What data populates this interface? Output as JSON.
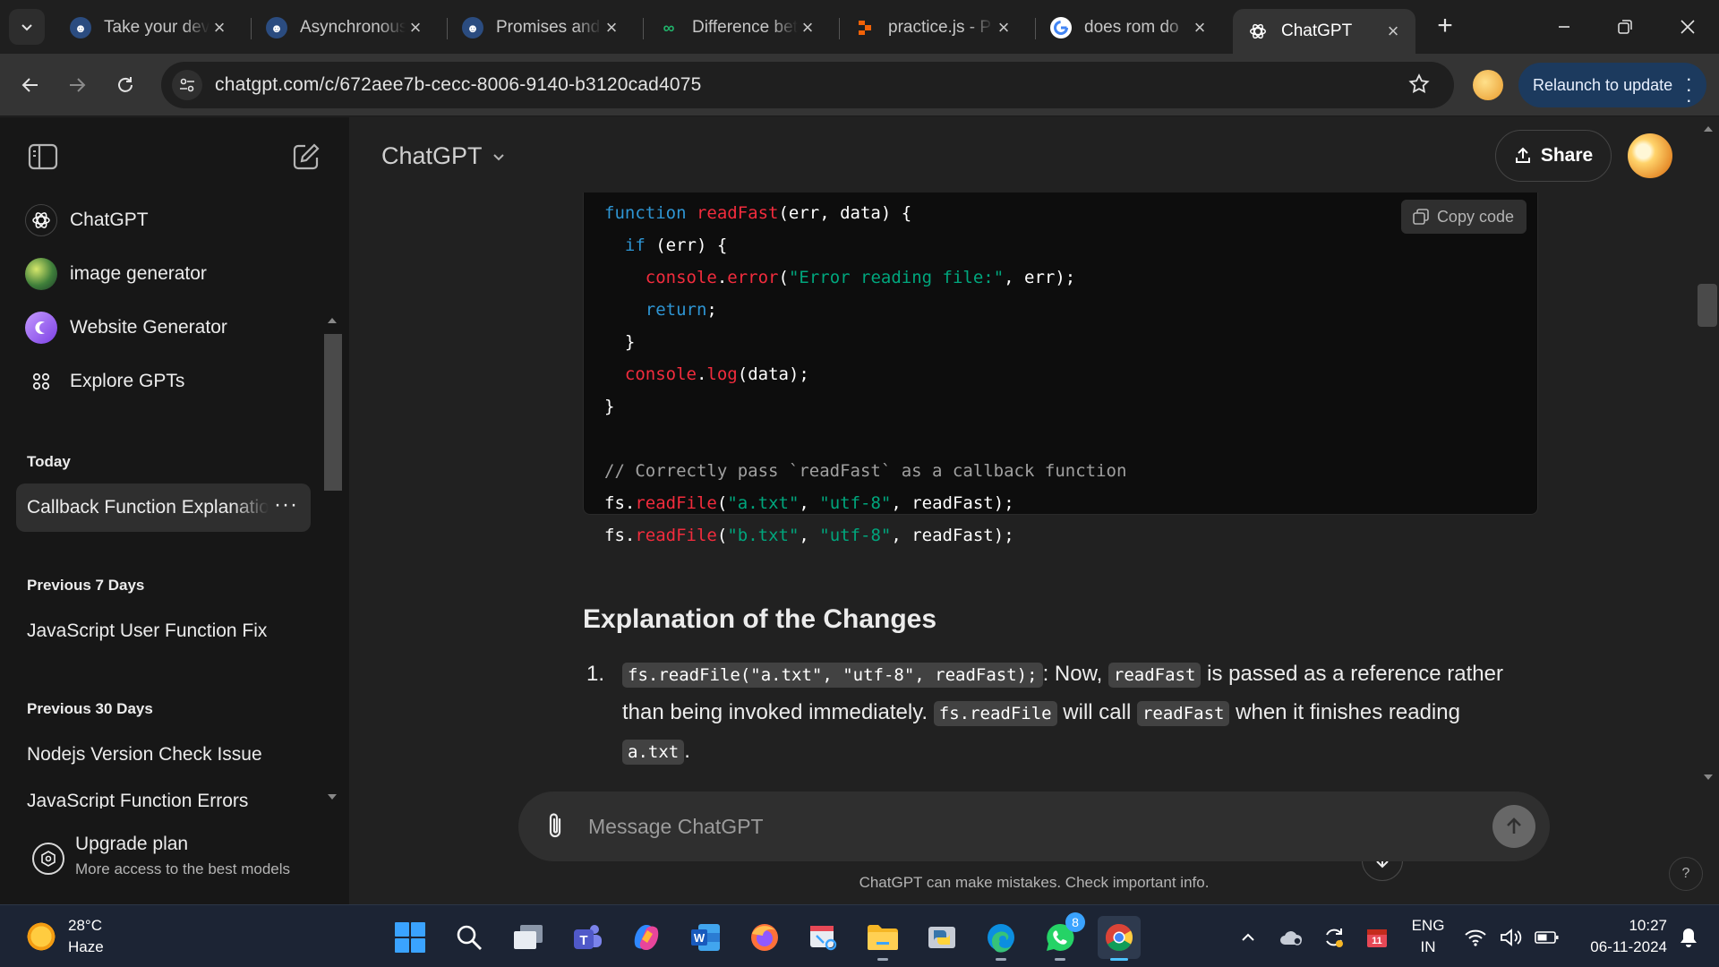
{
  "browser": {
    "tabs": [
      {
        "title": "Take your dev",
        "fav_bg": "#2b4c80",
        "fav_text": "☻"
      },
      {
        "title": "Asynchronous",
        "fav_bg": "#2b4c80",
        "fav_text": "☻"
      },
      {
        "title": "Promises and",
        "fav_bg": "#2b4c80",
        "fav_text": "☻"
      },
      {
        "title": "Difference bet",
        "fav_bg": "#1f1f1f",
        "fav_text": "∞"
      },
      {
        "title": "practice.js - P",
        "fav_bg": "#1f1f1f",
        "fav_text": "▚"
      },
      {
        "title": "does rom do",
        "fav_bg": "#ffffff",
        "fav_text": "G"
      },
      {
        "title": "ChatGPT",
        "fav_bg": "#343434",
        "fav_text": "✺"
      }
    ],
    "url": "chatgpt.com/c/672aee7b-cecc-8006-9140-b3120cad4075",
    "relaunch_label": "Relaunch to update"
  },
  "sidebar": {
    "gpts": [
      {
        "label": "ChatGPT",
        "icon": "chatgpt-logo-icon"
      },
      {
        "label": "image generator",
        "icon": "image-generator-icon"
      },
      {
        "label": "Website Generator",
        "icon": "website-generator-icon"
      },
      {
        "label": "Explore GPTs",
        "icon": "grid-icon"
      }
    ],
    "sections": [
      {
        "heading": "Today",
        "chats": [
          "Callback Function Explanation"
        ]
      },
      {
        "heading": "Previous 7 Days",
        "chats": [
          "JavaScript User Function Fix"
        ]
      },
      {
        "heading": "Previous 30 Days",
        "chats": [
          "Nodejs Version Check Issue",
          "JavaScript Function Errors"
        ]
      }
    ],
    "upgrade": {
      "title": "Upgrade plan",
      "subtitle": "More access to the best models"
    }
  },
  "main": {
    "model_title": "ChatGPT",
    "share_label": "Share",
    "copy_code_label": "Copy code",
    "code_lines": [
      [
        {
          "t": "function ",
          "c": "kw"
        },
        {
          "t": "readFast",
          "c": "fn"
        },
        {
          "t": "(err, data) {",
          "c": ""
        }
      ],
      [
        {
          "t": "  ",
          "c": ""
        },
        {
          "t": "if",
          "c": "kw"
        },
        {
          "t": " (err) {",
          "c": ""
        }
      ],
      [
        {
          "t": "    ",
          "c": ""
        },
        {
          "t": "console",
          "c": "fn"
        },
        {
          "t": ".",
          "c": ""
        },
        {
          "t": "error",
          "c": "fn"
        },
        {
          "t": "(",
          "c": ""
        },
        {
          "t": "\"Error reading file:\"",
          "c": "str"
        },
        {
          "t": ", err);",
          "c": ""
        }
      ],
      [
        {
          "t": "    ",
          "c": ""
        },
        {
          "t": "return",
          "c": "kw"
        },
        {
          "t": ";",
          "c": ""
        }
      ],
      [
        {
          "t": "  }",
          "c": ""
        }
      ],
      [
        {
          "t": "  ",
          "c": ""
        },
        {
          "t": "console",
          "c": "fn"
        },
        {
          "t": ".",
          "c": ""
        },
        {
          "t": "log",
          "c": "fn"
        },
        {
          "t": "(data);",
          "c": ""
        }
      ],
      [
        {
          "t": "}",
          "c": ""
        }
      ],
      [
        {
          "t": "",
          "c": ""
        }
      ],
      [
        {
          "t": "// Correctly pass `readFast` as a callback function",
          "c": "cm"
        }
      ],
      [
        {
          "t": "fs",
          "c": ""
        },
        {
          "t": ".",
          "c": ""
        },
        {
          "t": "readFile",
          "c": "fn"
        },
        {
          "t": "(",
          "c": ""
        },
        {
          "t": "\"a.txt\"",
          "c": "str"
        },
        {
          "t": ", ",
          "c": ""
        },
        {
          "t": "\"utf-8\"",
          "c": "str"
        },
        {
          "t": ", readFast);",
          "c": ""
        }
      ],
      [
        {
          "t": "fs",
          "c": ""
        },
        {
          "t": ".",
          "c": ""
        },
        {
          "t": "readFile",
          "c": "fn"
        },
        {
          "t": "(",
          "c": ""
        },
        {
          "t": "\"b.txt\"",
          "c": "str"
        },
        {
          "t": ", ",
          "c": ""
        },
        {
          "t": "\"utf-8\"",
          "c": "str"
        },
        {
          "t": ", readFast);",
          "c": ""
        }
      ]
    ],
    "heading": "Explanation of the Changes",
    "item1": {
      "num": "1.",
      "code1": "fs.readFile(\"a.txt\", \"utf-8\", readFast);",
      "t1": ": Now, ",
      "code2": "readFast",
      "t2": " is passed as a reference rather",
      "t3": "than being invoked immediately. ",
      "code3": "fs.readFile",
      "t4": " will call ",
      "code4": "readFast",
      "t5": " when it finishes reading",
      "code5": "a.txt",
      "t6": "."
    },
    "composer_placeholder": "Message ChatGPT",
    "disclaimer": "ChatGPT can make mistakes. Check important info.",
    "help_label": "?"
  },
  "taskbar": {
    "temperature": "28°C",
    "weather": "Haze",
    "whatsapp_badge": "8",
    "calendar_badge": "11",
    "language": "ENG",
    "region": "IN",
    "time": "10:27",
    "date": "06-11-2024"
  },
  "colors": {
    "keyword": "#2e95d3",
    "function": "#f22c3d",
    "string": "#00a67d",
    "comment": "#a0a0a0",
    "accent": "#4cc2ff"
  }
}
